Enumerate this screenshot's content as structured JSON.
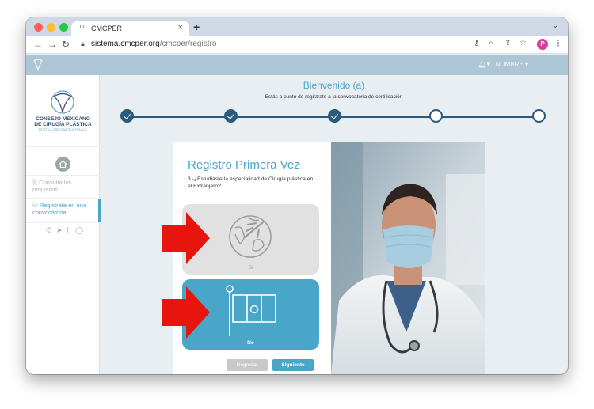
{
  "browser": {
    "tab_title": "CMCPER",
    "tab_close": "×",
    "new_tab": "+",
    "url_domain": "sistema.cmcper.org",
    "url_path": "/cmcper/registro",
    "profile_initial": "P"
  },
  "header": {
    "user_label": "NOMBRE",
    "user_caret": "▾",
    "bell_caret": "▾"
  },
  "sidebar": {
    "org_line1": "CONSEJO MEXICANO",
    "org_line2": "DE CIRUGÍA PLÁSTICA",
    "org_sub": "ESTÉTICA Y RECONSTRUCTIVA, A.C.",
    "items": [
      {
        "label": "Consulta los requisitos"
      },
      {
        "label": "Registrate en una convocatoria"
      }
    ]
  },
  "main": {
    "welcome_title": "Bienvenido (a)",
    "welcome_subtitle": "Estás a punto de registrate a la convocatoria de certificación",
    "steps": [
      "done",
      "done",
      "done",
      "todo",
      "todo"
    ]
  },
  "card": {
    "title": "Registro Primera Vez",
    "question": "3.-¿Estudiaste la especialidad de Cirugía plástica en el Extranjero?",
    "option_yes": "Si",
    "option_no": "No",
    "back_label": "Regresar",
    "next_label": "Siguiente"
  },
  "colors": {
    "accent": "#4aa6c9",
    "progress": "#2b5b7c",
    "arrow": "#e8150f"
  }
}
